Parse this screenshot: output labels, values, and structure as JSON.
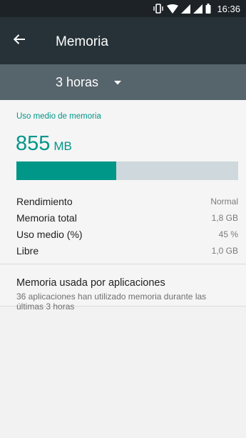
{
  "status_bar": {
    "time": "16:36",
    "icons": [
      "vibrate-icon",
      "wifi-icon",
      "signal-icon",
      "signal-icon",
      "battery-icon"
    ]
  },
  "toolbar": {
    "title": "Memoria",
    "back_icon": "arrow-back-icon"
  },
  "period": {
    "selected": "3 horas",
    "icon": "dropdown-arrow-icon"
  },
  "memory": {
    "section_title": "Uso medio de memoria",
    "value": "855",
    "unit": "MB",
    "usage_fraction": 0.45,
    "stats": [
      {
        "label": "Rendimiento",
        "value": "Normal"
      },
      {
        "label": "Memoria total",
        "value": "1,8 GB"
      },
      {
        "label": "Uso medio (%)",
        "value": "45 %"
      },
      {
        "label": "Libre",
        "value": "1,0 GB"
      }
    ]
  },
  "apps": {
    "title": "Memoria usada por aplicaciones",
    "description": "36 aplicaciones han utilizado memoria durante las últimas 3 horas"
  },
  "colors": {
    "accent": "#009688",
    "toolbar": "#263238",
    "selector": "#56646b",
    "track": "#cfd8dc"
  }
}
